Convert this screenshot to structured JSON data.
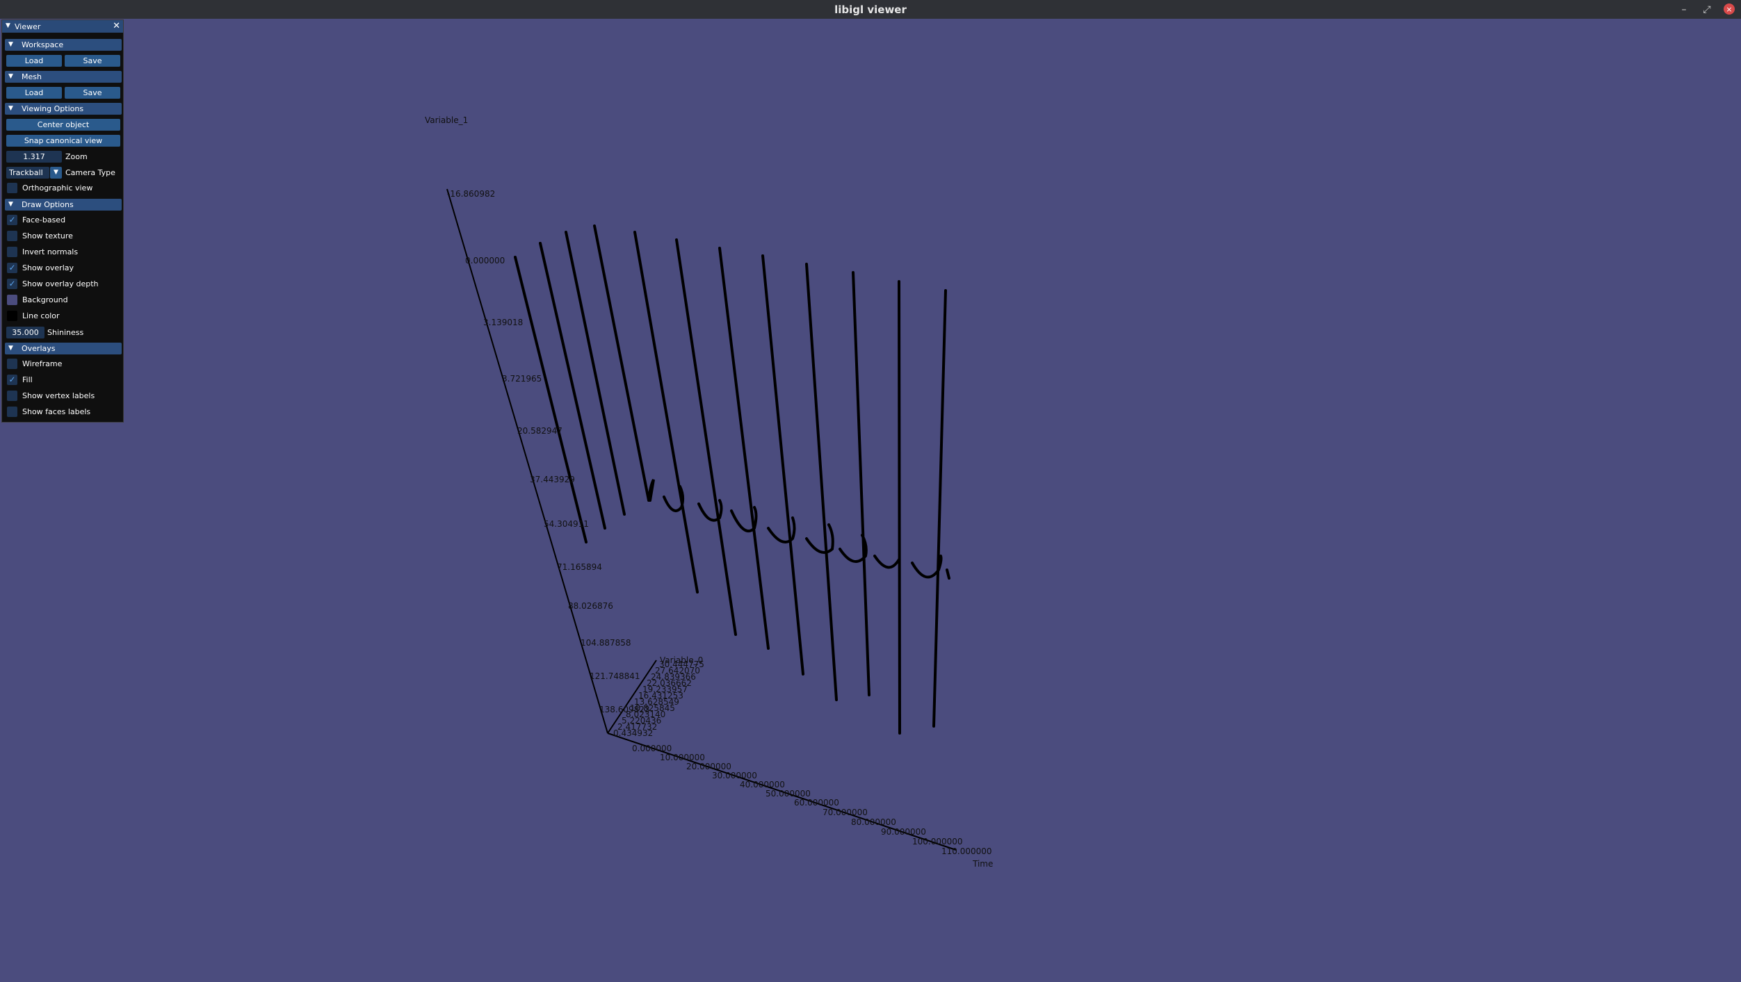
{
  "window": {
    "title": "libigl viewer",
    "controls": {
      "minimize": "–",
      "maximize": "⤢",
      "close": "×"
    }
  },
  "colors": {
    "background": "#4b4c7e",
    "line": "#000000",
    "panel": "#0f0f0f",
    "header": "#2c4e7e",
    "button": "#2a5a8c",
    "accent": "#5aa0e8"
  },
  "panel": {
    "title": "Viewer",
    "workspace": {
      "header": "Workspace",
      "load": "Load",
      "save": "Save"
    },
    "mesh": {
      "header": "Mesh",
      "load": "Load",
      "save": "Save"
    },
    "viewing_options": {
      "header": "Viewing Options",
      "center_object": "Center object",
      "snap_canonical": "Snap canonical view",
      "zoom_value": "1.317",
      "zoom_label": "Zoom",
      "camera_value": "Trackball",
      "camera_label": "Camera Type",
      "orthographic": {
        "label": "Orthographic view",
        "checked": false
      }
    },
    "draw_options": {
      "header": "Draw Options",
      "face_based": {
        "label": "Face-based",
        "checked": true
      },
      "show_texture": {
        "label": "Show texture",
        "checked": false
      },
      "invert_normals": {
        "label": "Invert normals",
        "checked": false
      },
      "show_overlay": {
        "label": "Show overlay",
        "checked": true
      },
      "show_overlay_depth": {
        "label": "Show overlay depth",
        "checked": true
      },
      "background": {
        "label": "Background",
        "color": "#4b4c7e"
      },
      "line_color": {
        "label": "Line color",
        "color": "#000000"
      },
      "shininess_value": "35.000",
      "shininess_label": "Shininess"
    },
    "overlays": {
      "header": "Overlays",
      "wireframe": {
        "label": "Wireframe",
        "checked": false
      },
      "fill": {
        "label": "Fill",
        "checked": true
      },
      "vertex_labels": {
        "label": "Show vertex labels",
        "checked": false
      },
      "faces_labels": {
        "label": "Show faces labels",
        "checked": false
      }
    }
  },
  "plot": {
    "axis_variable_1": {
      "name": "Variable_1",
      "ticks": [
        "-16.860982",
        "0.000000",
        "3.139018",
        "3.721965",
        "20.582947",
        "37.443929",
        "54.304911",
        "71.165894",
        "88.026876",
        "104.887858",
        "121.748841",
        "138.609823"
      ]
    },
    "axis_time": {
      "name": "Time",
      "ticks": [
        "0.000000",
        "10.000000",
        "20.000000",
        "30.000000",
        "40.000000",
        "50.000000",
        "60.000000",
        "70.000000",
        "80.000000",
        "90.000000",
        "100.000000",
        "110.000000"
      ]
    },
    "axis_variable_0": {
      "name": "Variable_0",
      "ticks": [
        "0.434932",
        "2.417732",
        "5.220436",
        "8.023140",
        "10.825845",
        "13.628549",
        "16.431253",
        "19.233957",
        "22.036662",
        "24.839366",
        "27.642070",
        "30.444775"
      ]
    }
  }
}
